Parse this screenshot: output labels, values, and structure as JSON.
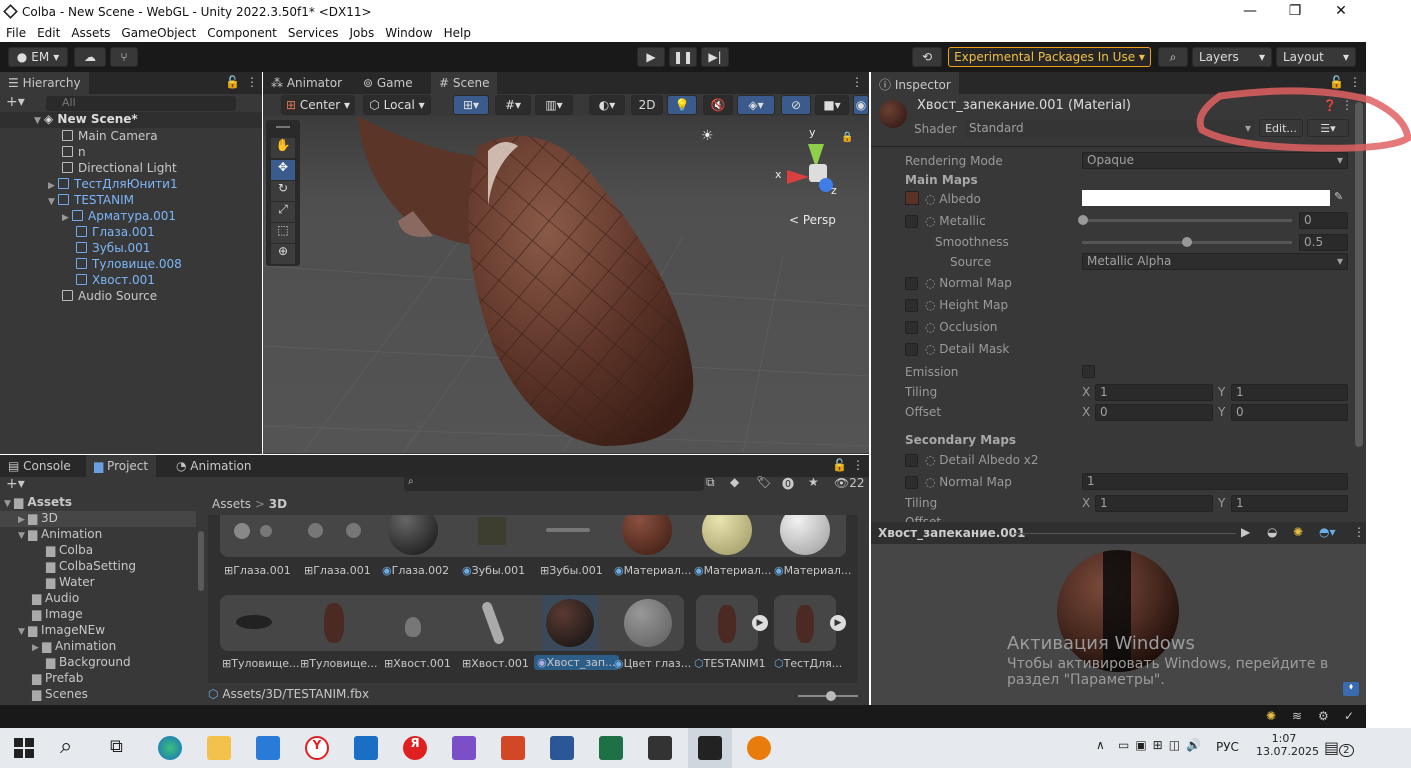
{
  "window": {
    "title": "Colba - New Scene - WebGL - Unity 2022.3.50f1* <DX11>",
    "minimize": "—",
    "maximize": "❐",
    "close": "✕"
  },
  "menu": [
    "File",
    "Edit",
    "Assets",
    "GameObject",
    "Component",
    "Services",
    "Jobs",
    "Window",
    "Help"
  ],
  "toolbar": {
    "account": "EM",
    "experimental": "Experimental Packages In Use",
    "layers": "Layers",
    "layout": "Layout"
  },
  "hierarchy": {
    "tab": "Hierarchy",
    "search_placeholder": "All",
    "scene": "New Scene*",
    "items": [
      {
        "label": "Main Camera",
        "blue": false
      },
      {
        "label": "n",
        "blue": false
      },
      {
        "label": "Directional Light",
        "blue": false
      },
      {
        "label": "ТестДляЮнити1",
        "blue": true
      },
      {
        "label": "TESTANIM",
        "blue": true
      },
      {
        "label": "Арматура.001",
        "blue": true
      },
      {
        "label": "Глаза.001",
        "blue": true
      },
      {
        "label": "Зубы.001",
        "blue": true
      },
      {
        "label": "Туловище.008",
        "blue": true
      },
      {
        "label": "Хвост.001",
        "blue": true
      },
      {
        "label": "Audio Source",
        "blue": false
      }
    ]
  },
  "center_tabs": [
    "Animator",
    "Game",
    "Scene"
  ],
  "scene_toolbar": {
    "pivot": "Center",
    "space": "Local",
    "mode2d": "2D",
    "persp": "< Persp",
    "gizmo": {
      "x": "x",
      "y": "y",
      "z": "z"
    }
  },
  "inspector": {
    "tab": "Inspector",
    "title": "Хвост_запекание.001 (Material)",
    "shader_label": "Shader",
    "shader": "Standard",
    "edit": "Edit...",
    "rendering_mode_label": "Rendering Mode",
    "rendering_mode": "Opaque",
    "main_maps": "Main Maps",
    "albedo": "Albedo",
    "metallic": "Metallic",
    "metallic_value": "0",
    "smoothness": "Smoothness",
    "smoothness_value": "0.5",
    "source": "Source",
    "source_value": "Metallic Alpha",
    "normal_map": "Normal Map",
    "height_map": "Height Map",
    "occlusion": "Occlusion",
    "detail_mask": "Detail Mask",
    "emission": "Emission",
    "tiling": "Tiling",
    "offset": "Offset",
    "x": "X",
    "y": "Y",
    "tiling_x": "1",
    "tiling_y": "1",
    "offset_x": "0",
    "offset_y": "0",
    "secondary_maps": "Secondary Maps",
    "detail_albedo": "Detail Albedo x2",
    "normal_map2": "Normal Map",
    "normal_value": "1",
    "tiling2": "Tiling",
    "tiling2_x": "1",
    "tiling2_y": "1",
    "offset2": "Offset",
    "preview_title": "Хвост_запекание.001"
  },
  "bottom_tabs": [
    "Console",
    "Project",
    "Animation"
  ],
  "project": {
    "tree": [
      {
        "label": "Assets",
        "level": 0,
        "bold": true
      },
      {
        "label": "3D",
        "level": 1
      },
      {
        "label": "Animation",
        "level": 1
      },
      {
        "label": "Colba",
        "level": 2
      },
      {
        "label": "ColbaSetting",
        "level": 2
      },
      {
        "label": "Water",
        "level": 2
      },
      {
        "label": "Audio",
        "level": 1
      },
      {
        "label": "Image",
        "level": 1
      },
      {
        "label": "ImageNEw",
        "level": 1
      },
      {
        "label": "Animation",
        "level": 2
      },
      {
        "label": "Background",
        "level": 2
      },
      {
        "label": "Prefab",
        "level": 1
      },
      {
        "label": "Scenes",
        "level": 1
      }
    ],
    "breadcrumb": [
      "Assets",
      "3D"
    ],
    "count": "22",
    "row1": [
      "Глаза.001",
      "Глаза.001",
      "Глаза.002",
      "Зубы.001",
      "Зубы.001",
      "Материал...",
      "Материал...",
      "Материал..."
    ],
    "row2": [
      "Туловище...",
      "Туловище...",
      "Хвост.001",
      "Хвост.001",
      "Хвост_зап...",
      "Цвет глаз...",
      "TESTANIM1",
      "ТестДля..."
    ],
    "path": "Assets/3D/TESTANIM.fbx"
  },
  "watermark": {
    "line1": "Активация Windows",
    "line2": "Чтобы активировать Windows, перейдите в",
    "line3": "раздел \"Параметры\"."
  },
  "taskbar": {
    "lang": "РУС",
    "time": "1:07",
    "date": "13.07.2025",
    "notif": "2"
  },
  "colors": {
    "accent_orange": "#f0a01a",
    "annotation": "#e06060",
    "blue_text": "#7db6f8"
  }
}
